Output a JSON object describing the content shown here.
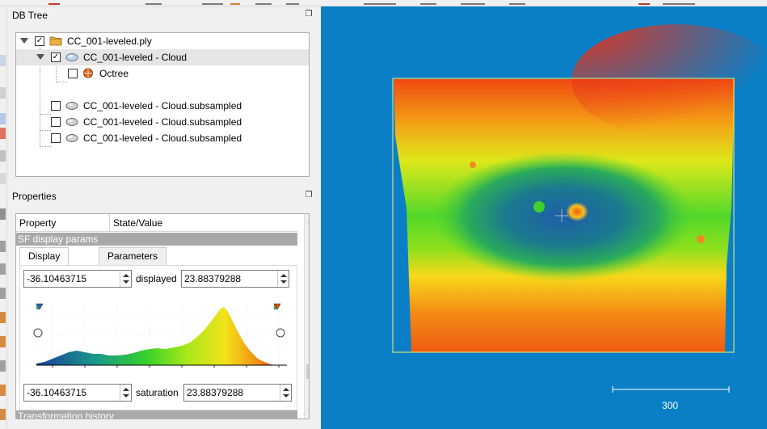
{
  "db_tree": {
    "title": "DB Tree",
    "items": [
      {
        "label": "CC_001-leveled.ply",
        "checked": true,
        "expanded": true,
        "icon": "folder-icon"
      },
      {
        "label": "CC_001-leveled - Cloud",
        "checked": true,
        "expanded": true,
        "icon": "cloud-icon",
        "selected": true
      },
      {
        "label": "Octree",
        "checked": false,
        "icon": "octree-icon"
      },
      {
        "label": "CC_001-leveled - Cloud.subsampled",
        "checked": false,
        "icon": "cloud-icon"
      },
      {
        "label": "CC_001-leveled - Cloud.subsampled",
        "checked": false,
        "icon": "cloud-icon"
      },
      {
        "label": "CC_001-leveled - Cloud.subsampled",
        "checked": false,
        "icon": "cloud-icon"
      }
    ]
  },
  "properties": {
    "title": "Properties",
    "col_property": "Property",
    "col_value": "State/Value",
    "section_sf": "SF display params",
    "section_history": "Transformation history",
    "tabs": [
      "Display ranges",
      "Parameters"
    ],
    "active_tab": 0,
    "displayed_label": "displayed",
    "saturation_label": "saturation",
    "displayed_min": "-36.10463715",
    "displayed_max": "23.88379288",
    "saturation_min": "-36.10463715",
    "saturation_max": "23.88379288"
  },
  "view3d": {
    "scale_label": "300",
    "background": "#0a7fc6"
  }
}
